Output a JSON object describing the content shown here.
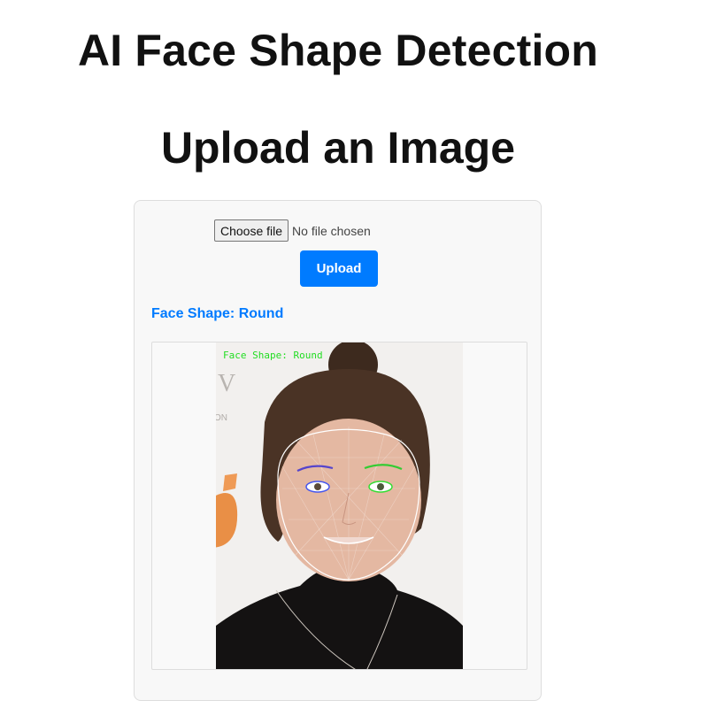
{
  "header": {
    "title": "AI Face Shape Detection",
    "subtitle": "Upload an Image"
  },
  "form": {
    "choose_file_label": "Choose file",
    "file_status": "No file chosen",
    "upload_label": "Upload"
  },
  "result": {
    "label": "Face Shape: Round",
    "overlay_label": "Face Shape: Round"
  },
  "colors": {
    "accent": "#007bff",
    "overlay_text": "#22dd22",
    "mesh_left_eye": "#4455ee",
    "mesh_right_eye": "#33dd33"
  }
}
